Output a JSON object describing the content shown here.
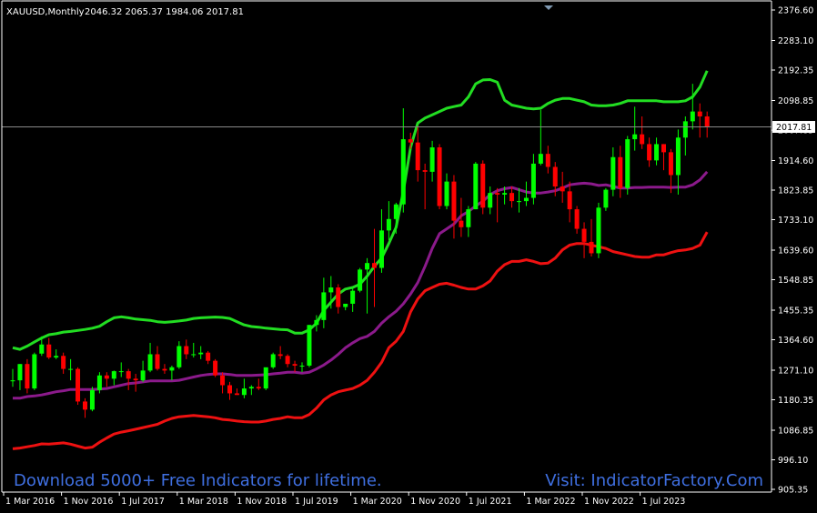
{
  "chart_data": {
    "type": "candlestick",
    "title": "XAUUSD,Monthly",
    "ohlc_header": "2046.32 2065.37 1984.06 2017.81",
    "current_price_label": "2017.81",
    "current_price": 2017.81,
    "y_ticks": [
      "2376.60",
      "2283.10",
      "2192.35",
      "2098.85",
      "2007.85",
      "1914.60",
      "1823.85",
      "1733.10",
      "1639.60",
      "1548.85",
      "1455.35",
      "1364.60",
      "1271.10",
      "1180.35",
      "1086.85",
      "996.10",
      "905.35"
    ],
    "ylim": [
      905.35,
      2376.6
    ],
    "x_ticks": [
      "1 Mar 2016",
      "1 Nov 2016",
      "1 Jul 2017",
      "1 Mar 2018",
      "1 Nov 2018",
      "1 Jul 2019",
      "1 Mar 2020",
      "1 Nov 2020",
      "1 Jul 2021",
      "1 Mar 2022",
      "1 Nov 2022",
      "1 Jul 2023"
    ],
    "candles": [
      [
        1237,
        1275,
        1220,
        1240
      ],
      [
        1240,
        1290,
        1210,
        1290
      ],
      [
        1290,
        1305,
        1200,
        1215
      ],
      [
        1215,
        1325,
        1210,
        1320
      ],
      [
        1322,
        1375,
        1315,
        1350
      ],
      [
        1350,
        1370,
        1305,
        1310
      ],
      [
        1310,
        1335,
        1305,
        1315
      ],
      [
        1315,
        1325,
        1260,
        1275
      ],
      [
        1275,
        1305,
        1240,
        1275
      ],
      [
        1275,
        1280,
        1165,
        1175
      ],
      [
        1175,
        1185,
        1125,
        1150
      ],
      [
        1150,
        1220,
        1145,
        1210
      ],
      [
        1210,
        1265,
        1200,
        1255
      ],
      [
        1255,
        1265,
        1220,
        1245
      ],
      [
        1245,
        1270,
        1225,
        1268
      ],
      [
        1268,
        1295,
        1250,
        1268
      ],
      [
        1268,
        1275,
        1210,
        1245
      ],
      [
        1245,
        1260,
        1205,
        1240
      ],
      [
        1240,
        1300,
        1235,
        1270
      ],
      [
        1270,
        1355,
        1265,
        1320
      ],
      [
        1320,
        1345,
        1270,
        1275
      ],
      [
        1275,
        1290,
        1260,
        1270
      ],
      [
        1270,
        1285,
        1240,
        1280
      ],
      [
        1280,
        1360,
        1275,
        1345
      ],
      [
        1345,
        1365,
        1305,
        1320
      ],
      [
        1320,
        1355,
        1310,
        1320
      ],
      [
        1320,
        1345,
        1305,
        1325
      ],
      [
        1325,
        1330,
        1290,
        1300
      ],
      [
        1300,
        1305,
        1250,
        1255
      ],
      [
        1255,
        1265,
        1200,
        1225
      ],
      [
        1225,
        1235,
        1180,
        1200
      ],
      [
        1200,
        1215,
        1195,
        1195
      ],
      [
        1195,
        1245,
        1185,
        1215
      ],
      [
        1215,
        1225,
        1195,
        1220
      ],
      [
        1220,
        1245,
        1210,
        1215
      ],
      [
        1215,
        1250,
        1210,
        1280
      ],
      [
        1280,
        1325,
        1275,
        1320
      ],
      [
        1320,
        1345,
        1305,
        1315
      ],
      [
        1315,
        1320,
        1280,
        1290
      ],
      [
        1290,
        1300,
        1265,
        1285
      ],
      [
        1285,
        1295,
        1265,
        1285
      ],
      [
        1285,
        1410,
        1280,
        1410
      ],
      [
        1410,
        1440,
        1390,
        1425
      ],
      [
        1425,
        1555,
        1400,
        1510
      ],
      [
        1510,
        1560,
        1460,
        1525
      ],
      [
        1525,
        1535,
        1445,
        1465
      ],
      [
        1465,
        1470,
        1455,
        1475
      ],
      [
        1475,
        1525,
        1450,
        1515
      ],
      [
        1515,
        1585,
        1510,
        1580
      ],
      [
        1580,
        1615,
        1445,
        1600
      ],
      [
        1600,
        1705,
        1465,
        1585
      ],
      [
        1585,
        1765,
        1570,
        1700
      ],
      [
        1700,
        1790,
        1670,
        1735
      ],
      [
        1735,
        1785,
        1690,
        1780
      ],
      [
        1780,
        2075,
        1755,
        1980
      ],
      [
        1980,
        2000,
        1950,
        1970
      ],
      [
        1970,
        2020,
        1850,
        1885
      ],
      [
        1885,
        1905,
        1765,
        1880
      ],
      [
        1880,
        1975,
        1850,
        1955
      ],
      [
        1955,
        1965,
        1765,
        1775
      ],
      [
        1775,
        1875,
        1765,
        1850
      ],
      [
        1850,
        1870,
        1675,
        1730
      ],
      [
        1730,
        1800,
        1680,
        1710
      ],
      [
        1710,
        1775,
        1680,
        1765
      ],
      [
        1765,
        1910,
        1765,
        1905
      ],
      [
        1905,
        1915,
        1750,
        1770
      ],
      [
        1770,
        1835,
        1750,
        1815
      ],
      [
        1815,
        1830,
        1725,
        1810
      ],
      [
        1810,
        1835,
        1780,
        1815
      ],
      [
        1815,
        1835,
        1770,
        1790
      ],
      [
        1790,
        1830,
        1755,
        1790
      ],
      [
        1790,
        1850,
        1775,
        1800
      ],
      [
        1800,
        1935,
        1780,
        1905
      ],
      [
        1905,
        2070,
        1900,
        1935
      ],
      [
        1935,
        1960,
        1875,
        1895
      ],
      [
        1895,
        1910,
        1805,
        1835
      ],
      [
        1835,
        1880,
        1785,
        1820
      ],
      [
        1820,
        1850,
        1725,
        1765
      ],
      [
        1765,
        1775,
        1690,
        1705
      ],
      [
        1705,
        1725,
        1615,
        1665
      ],
      [
        1665,
        1735,
        1620,
        1630
      ],
      [
        1630,
        1785,
        1615,
        1770
      ],
      [
        1770,
        1830,
        1760,
        1825
      ],
      [
        1825,
        1955,
        1805,
        1925
      ],
      [
        1925,
        1960,
        1800,
        1830
      ],
      [
        1830,
        1990,
        1810,
        1980
      ],
      [
        1980,
        2080,
        1945,
        1995
      ],
      [
        1995,
        2050,
        1950,
        1965
      ],
      [
        1965,
        1985,
        1895,
        1915
      ],
      [
        1915,
        1985,
        1900,
        1965
      ],
      [
        1965,
        1965,
        1885,
        1940
      ],
      [
        1940,
        1950,
        1815,
        1870
      ],
      [
        1870,
        2010,
        1810,
        1985
      ],
      [
        1985,
        2050,
        1930,
        2035
      ],
      [
        2035,
        2150,
        2010,
        2065
      ],
      [
        2065,
        2090,
        1985,
        2050
      ],
      [
        2050,
        2065,
        1985,
        2018
      ]
    ],
    "series": [
      {
        "name": "",
        "color": "#22dd22",
        "values": [
          1340,
          1335,
          1345,
          1358,
          1370,
          1380,
          1383,
          1388,
          1390,
          1393,
          1396,
          1400,
          1406,
          1420,
          1432,
          1435,
          1432,
          1428,
          1426,
          1424,
          1420,
          1418,
          1420,
          1422,
          1425,
          1430,
          1432,
          1433,
          1434,
          1433,
          1430,
          1420,
          1410,
          1405,
          1403,
          1400,
          1398,
          1396,
          1395,
          1385,
          1385,
          1395,
          1415,
          1455,
          1480,
          1505,
          1520,
          1525,
          1535,
          1560,
          1590,
          1615,
          1660,
          1710,
          1820,
          1955,
          2030,
          2045,
          2055,
          2065,
          2075,
          2080,
          2085,
          2110,
          2150,
          2162,
          2163,
          2155,
          2100,
          2085,
          2080,
          2075,
          2073,
          2075,
          2090,
          2100,
          2105,
          2105,
          2100,
          2095,
          2085,
          2083,
          2083,
          2085,
          2090,
          2098,
          2098,
          2098,
          2098,
          2098,
          2095,
          2095,
          2095,
          2098,
          2110,
          2140,
          2190
        ]
      },
      {
        "name": "",
        "color": "#8b1a8b",
        "values": [
          1185,
          1185,
          1190,
          1192,
          1195,
          1200,
          1205,
          1208,
          1212,
          1212,
          1212,
          1212,
          1213,
          1215,
          1220,
          1225,
          1230,
          1232,
          1235,
          1238,
          1238,
          1238,
          1238,
          1240,
          1245,
          1250,
          1255,
          1258,
          1260,
          1260,
          1258,
          1255,
          1255,
          1255,
          1256,
          1257,
          1260,
          1262,
          1265,
          1265,
          1262,
          1265,
          1275,
          1287,
          1302,
          1320,
          1340,
          1355,
          1368,
          1375,
          1390,
          1415,
          1435,
          1452,
          1475,
          1505,
          1540,
          1590,
          1645,
          1690,
          1705,
          1720,
          1745,
          1758,
          1775,
          1790,
          1810,
          1822,
          1828,
          1832,
          1825,
          1818,
          1815,
          1815,
          1818,
          1822,
          1830,
          1840,
          1843,
          1845,
          1843,
          1838,
          1840,
          1835,
          1830,
          1830,
          1832,
          1832,
          1833,
          1833,
          1833,
          1832,
          1833,
          1833,
          1840,
          1855,
          1880
        ]
      },
      {
        "name": "",
        "color": "#ee1111",
        "values": [
          1030,
          1032,
          1036,
          1040,
          1045,
          1044,
          1046,
          1048,
          1044,
          1038,
          1032,
          1035,
          1050,
          1063,
          1075,
          1081,
          1085,
          1090,
          1095,
          1100,
          1105,
          1115,
          1123,
          1128,
          1130,
          1132,
          1130,
          1128,
          1125,
          1120,
          1118,
          1115,
          1113,
          1112,
          1112,
          1115,
          1120,
          1123,
          1128,
          1125,
          1125,
          1135,
          1155,
          1180,
          1195,
          1205,
          1210,
          1215,
          1225,
          1240,
          1265,
          1295,
          1340,
          1360,
          1390,
          1450,
          1490,
          1515,
          1525,
          1535,
          1538,
          1532,
          1525,
          1520,
          1520,
          1530,
          1545,
          1575,
          1595,
          1605,
          1605,
          1610,
          1605,
          1598,
          1600,
          1615,
          1640,
          1655,
          1660,
          1660,
          1655,
          1650,
          1645,
          1635,
          1630,
          1625,
          1620,
          1618,
          1618,
          1625,
          1625,
          1632,
          1638,
          1640,
          1645,
          1655,
          1695
        ]
      }
    ],
    "grid": false,
    "up_color": "#00ff00",
    "down_color": "#ff0000"
  },
  "watermark": {
    "left": "Download 5000+ Free Indicators for lifetime.",
    "right": "Visit: IndicatorFactory.Com"
  }
}
